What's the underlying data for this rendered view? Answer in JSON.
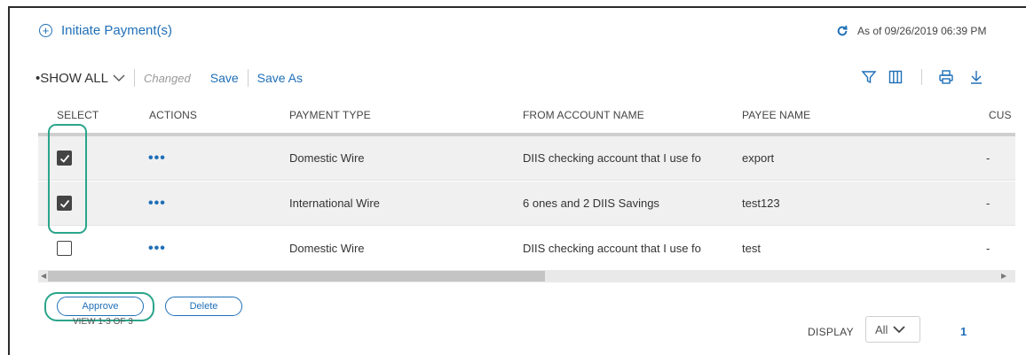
{
  "header": {
    "initiate_label": "Initiate Payment(s)",
    "as_of": "As of 09/26/2019 06:39 PM"
  },
  "toolbar": {
    "show_all": "•SHOW ALL",
    "changed": "Changed",
    "save": "Save",
    "save_as": "Save As",
    "icons": [
      "filter-icon",
      "columns-icon",
      "print-icon",
      "download-icon"
    ]
  },
  "table": {
    "columns": [
      "SELECT",
      "ACTIONS",
      "PAYMENT TYPE",
      "FROM ACCOUNT NAME",
      "PAYEE NAME",
      "CUS"
    ],
    "rows": [
      {
        "selected": true,
        "actions": "•••",
        "payment_type": "Domestic Wire",
        "from_account": "DIIS checking account that I use fo",
        "payee": "export",
        "cus": "-"
      },
      {
        "selected": true,
        "actions": "•••",
        "payment_type": "International Wire",
        "from_account": "6 ones and 2 DIIS Savings",
        "payee": "test123",
        "cus": "-"
      },
      {
        "selected": false,
        "actions": "•••",
        "payment_type": "Domestic Wire",
        "from_account": "DIIS checking account that I use fo",
        "payee": "test",
        "cus": "-"
      }
    ]
  },
  "footer": {
    "approve": "Approve",
    "delete": "Delete",
    "view_count": "VIEW 1-3 OF 3",
    "display_label": "DISPLAY",
    "display_value": "All",
    "page": "1"
  },
  "colors": {
    "accent": "#1f6fb7",
    "highlight": "#2aa58a"
  }
}
